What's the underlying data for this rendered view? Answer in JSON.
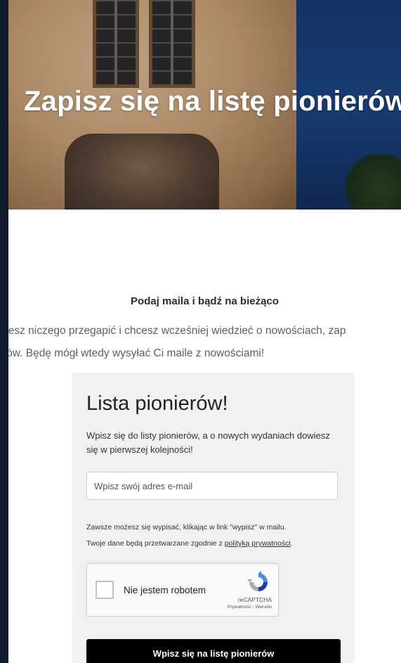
{
  "hero": {
    "title": "Zapisz się na listę pionierów"
  },
  "section": {
    "subtitle": "Podaj maila i bądź na bieżąco",
    "lead_line1": "cesz niczego przegapić i chcesz wcześniej wiedzieć o nowościach, zap",
    "lead_line2": "rów. Będę mógł wtedy wysyłać Ci maile z nowościami!"
  },
  "form": {
    "heading": "Lista pionierów!",
    "description": "Wpisz się do listy pionierów, a o nowych wydaniach dowiesz się w pierwszej kolejności!",
    "email_placeholder": "Wpisz swój adres e-mail",
    "email_value": "",
    "note_unsubscribe": "Zawsze możesz się wypisać, klikając w link \"wypisz\" w mailu.",
    "note_privacy_prefix": "Twoje dane będą przetwarzane zgodnie z ",
    "privacy_link": "polityką prywatności",
    "note_privacy_suffix": ".",
    "submit_label": "Wpisz się na listę pionierów"
  },
  "captcha": {
    "label": "Nie jestem robotem",
    "brand": "reCAPTCHA",
    "links": "Prywatność - Warunki",
    "checked": false
  },
  "colors": {
    "page_frame": "#101b2e",
    "card_background": "#f1f1f1",
    "button_background": "#000000",
    "hero_text": "#ffffff"
  }
}
